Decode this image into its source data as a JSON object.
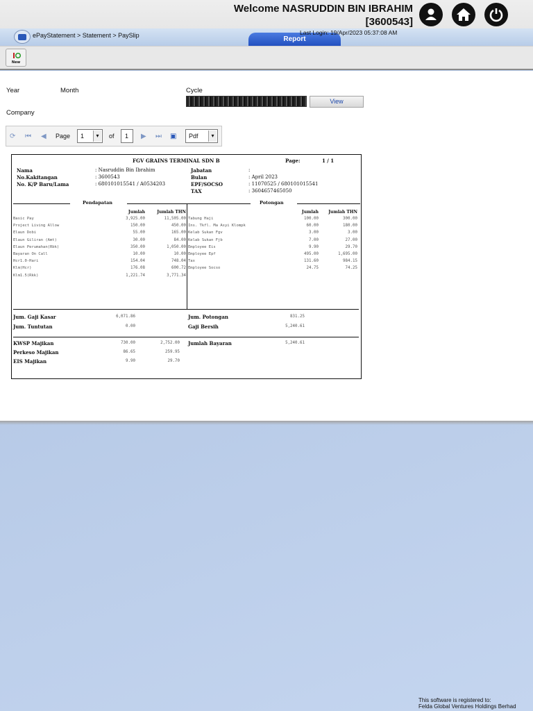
{
  "header": {
    "welcome_line1": "Welcome NASRUDDIN BIN IBRAHIM",
    "welcome_line2": "[3600543]",
    "last_login": "Last Login: 19/Apr/2023 05:37:08 AM",
    "icons": [
      "user-icon",
      "home-icon",
      "power-icon"
    ]
  },
  "nav": {
    "breadcrumb": "ePayStatement > Statement > PaySlip",
    "report_tab": "Report"
  },
  "toolbar": {
    "new_label": "New"
  },
  "filters": {
    "year_label": "Year",
    "month_label": "Month",
    "cycle_label": "Cycle",
    "company_label": "Company",
    "view_button": "View"
  },
  "pager": {
    "page_label": "Page",
    "page_value": "1",
    "of_label": "of",
    "total_pages": "1",
    "format_value": "Pdf"
  },
  "payslip": {
    "company": "FGV GRAINS TERMINAL SDN B",
    "page_label": "Page:",
    "page_value": "1 / 1",
    "info_left": [
      {
        "label": "Nama",
        "value": ": Nasruddin Bin Ibrahim"
      },
      {
        "label": "No.Kakitangan",
        "value": ": 3600543"
      },
      {
        "label": "No. K/P Baru/Lama",
        "value": ": 680101015541 / A0534203"
      }
    ],
    "info_right": [
      {
        "label": "Jabatan",
        "value": ":"
      },
      {
        "label": "Bulan",
        "value": ": April 2023"
      },
      {
        "label": "EPF/SOCSO",
        "value": ": 11070525     / 680101015541"
      },
      {
        "label": "TAX",
        "value": ": 3604657465050"
      }
    ],
    "pendapatan_title": "Pendapatan",
    "potongan_title": "Potongan",
    "col_jumlah": "Jumlah",
    "col_jumlah_thn": "Jumlah THN",
    "earnings": [
      {
        "name": "Basic Pay",
        "amt": "3,925.00",
        "ytd": "11,505.00"
      },
      {
        "name": "Project Living Allow",
        "amt": "150.00",
        "ytd": "450.00"
      },
      {
        "name": "Elaun Dobi",
        "amt": "55.00",
        "ytd": "165.00"
      },
      {
        "name": "Elaun Giliran (Amt)",
        "amt": "30.00",
        "ytd": "84.00"
      },
      {
        "name": "Elaun Perumahan(Rbk)",
        "amt": "350.00",
        "ytd": "1,050.00"
      },
      {
        "name": "Bayaran On Call",
        "amt": "10.00",
        "ytd": "10.00"
      },
      {
        "name": "Hcr1.0-Hari",
        "amt": "154.04",
        "ytd": "748.04"
      },
      {
        "name": "Klm(Hcr)",
        "amt": "176.08",
        "ytd": "600.72"
      },
      {
        "name": "Klm1.5(Rkk)",
        "amt": "1,221.74",
        "ytd": "3,771.34"
      }
    ],
    "deductions": [
      {
        "name": "Tabung Haji",
        "amt": "100.00",
        "ytd": "300.00"
      },
      {
        "name": "Ins. Tkfl. Ma Asyi Klompk",
        "amt": "60.00",
        "ytd": "180.00"
      },
      {
        "name": "Kelab Sukan Fgv",
        "amt": "3.00",
        "ytd": "3.00"
      },
      {
        "name": "Kelab Sukan Fjb",
        "amt": "7.00",
        "ytd": "27.00"
      },
      {
        "name": "Employee Eis",
        "amt": "9.90",
        "ytd": "29.70"
      },
      {
        "name": "Employee Epf",
        "amt": "495.00",
        "ytd": "1,695.00"
      },
      {
        "name": "Tax",
        "amt": "131.60",
        "ytd": "984.15"
      },
      {
        "name": "Employee Socso",
        "amt": "24.75",
        "ytd": "74.25"
      }
    ],
    "totals": {
      "gaji_kasar_label": "Jum. Gaji Kasar",
      "gaji_kasar": "6,071.86",
      "tuntutan_label": "Jum. Tuntutan",
      "tuntutan": "0.00",
      "potongan_label": "Jum. Potongan",
      "potongan": "831.25",
      "bersih_label": "Gaji Bersih",
      "bersih": "5,240.61"
    },
    "employer": [
      {
        "name": "KWSP Majikan",
        "amt": "730.00",
        "ytd": "2,752.00"
      },
      {
        "name": "Perkeso Majikan",
        "amt": "86.65",
        "ytd": "259.95"
      },
      {
        "name": "EIS Majikan",
        "amt": "9.90",
        "ytd": "29.70"
      }
    ],
    "bayaran_label": "Jumlah Bayaran",
    "bayaran": "5,240.61"
  },
  "footer": {
    "line1": "This software is registered to:",
    "line2": "Felda Global Ventures Holdings Berhad"
  }
}
